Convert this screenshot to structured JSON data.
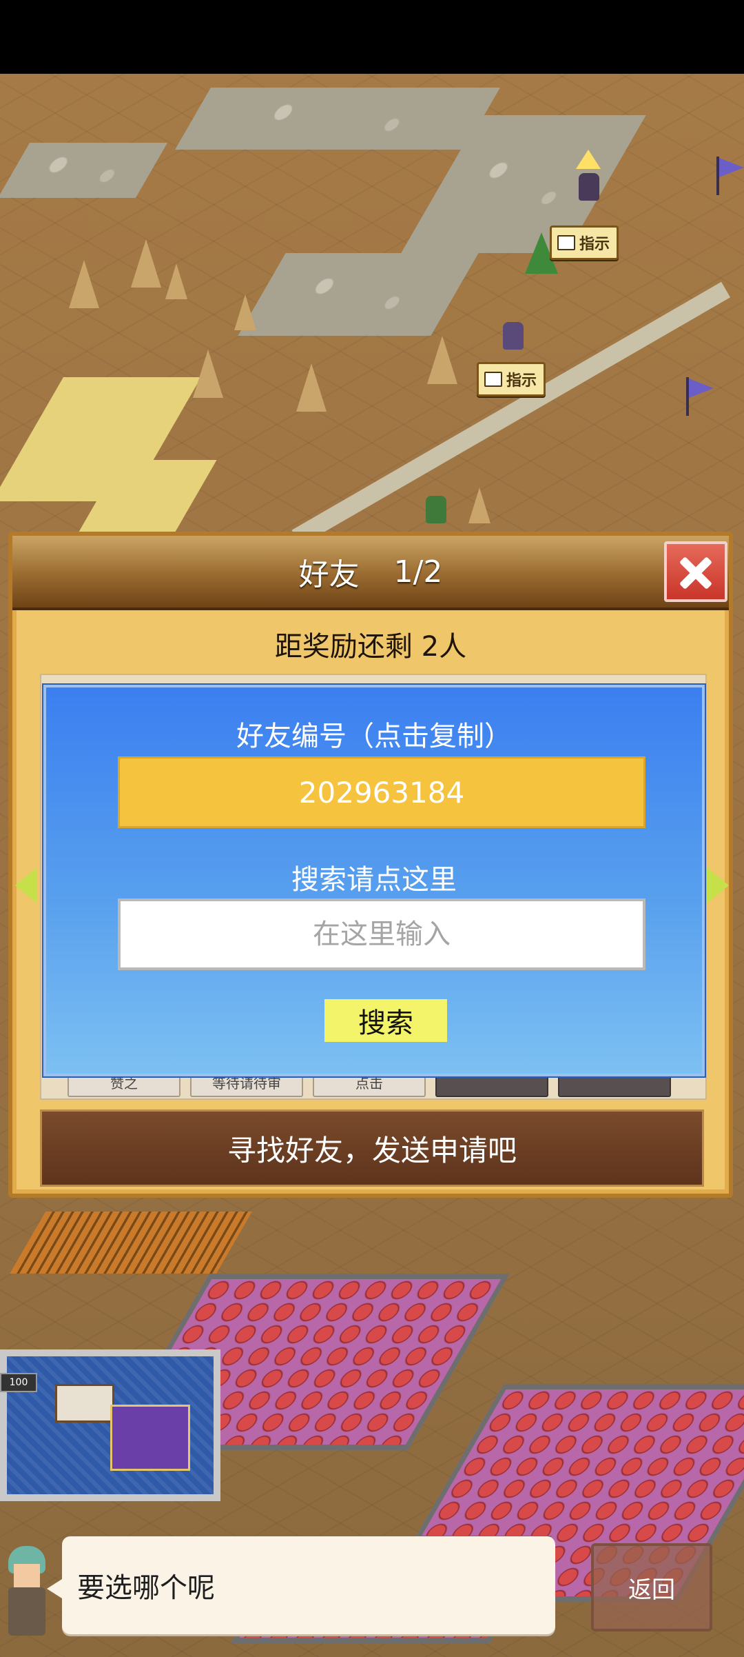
{
  "map": {
    "hint_sign_1": "指示",
    "hint_sign_2": "指示",
    "building_count": "100"
  },
  "friends_panel": {
    "title": "好友",
    "page": "1/2",
    "reward_remaining": "距奖励还剩 2人",
    "under_buttons": [
      "赞之",
      "等待请待审",
      "点击",
      "",
      ""
    ],
    "find_friends": "寻找好友，发送申请吧"
  },
  "friend_code_dialog": {
    "code_label": "好友编号（点击复制）",
    "friend_code": "202963184",
    "search_label": "搜索请点这里",
    "search_placeholder": "在这里输入",
    "search_button": "搜索"
  },
  "assistant": {
    "speech": "要选哪个呢"
  },
  "back_button": "返回",
  "colors": {
    "panel_bg": "#f0c66a",
    "dialog_blue": "#3b7ff0",
    "code_box": "#f5c33e",
    "search_button": "#f4f46a",
    "find_bar": "#6e3e22"
  }
}
